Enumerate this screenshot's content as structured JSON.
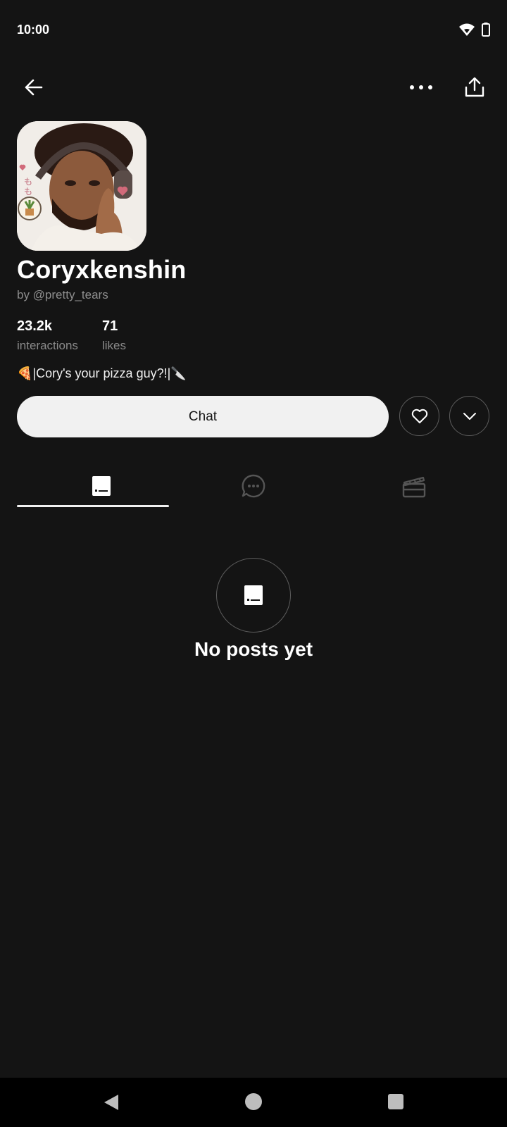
{
  "status_bar": {
    "time": "10:00"
  },
  "nav": {
    "back_icon": "back-arrow-icon",
    "more_icon": "more-dots-icon",
    "share_icon": "share-icon"
  },
  "profile": {
    "name": "Coryxkenshin",
    "creator": "by @pretty_tears",
    "stats": [
      {
        "value": "23.2k",
        "label": "interactions"
      },
      {
        "value": "71",
        "label": "likes"
      }
    ],
    "tagline": "🍕|Cory's your pizza guy?!|🔪"
  },
  "actions": {
    "chat_label": "Chat"
  },
  "tabs": [
    {
      "name": "posts",
      "icon": "posts-icon",
      "active": true
    },
    {
      "name": "chats",
      "icon": "chat-bubble-icon",
      "active": false
    },
    {
      "name": "scenes",
      "icon": "clapperboard-icon",
      "active": false
    }
  ],
  "empty_state": {
    "text": "No posts yet"
  },
  "colors": {
    "background": "#141414",
    "button_light": "#f1f1f1",
    "muted_text": "#8a8a8a"
  }
}
